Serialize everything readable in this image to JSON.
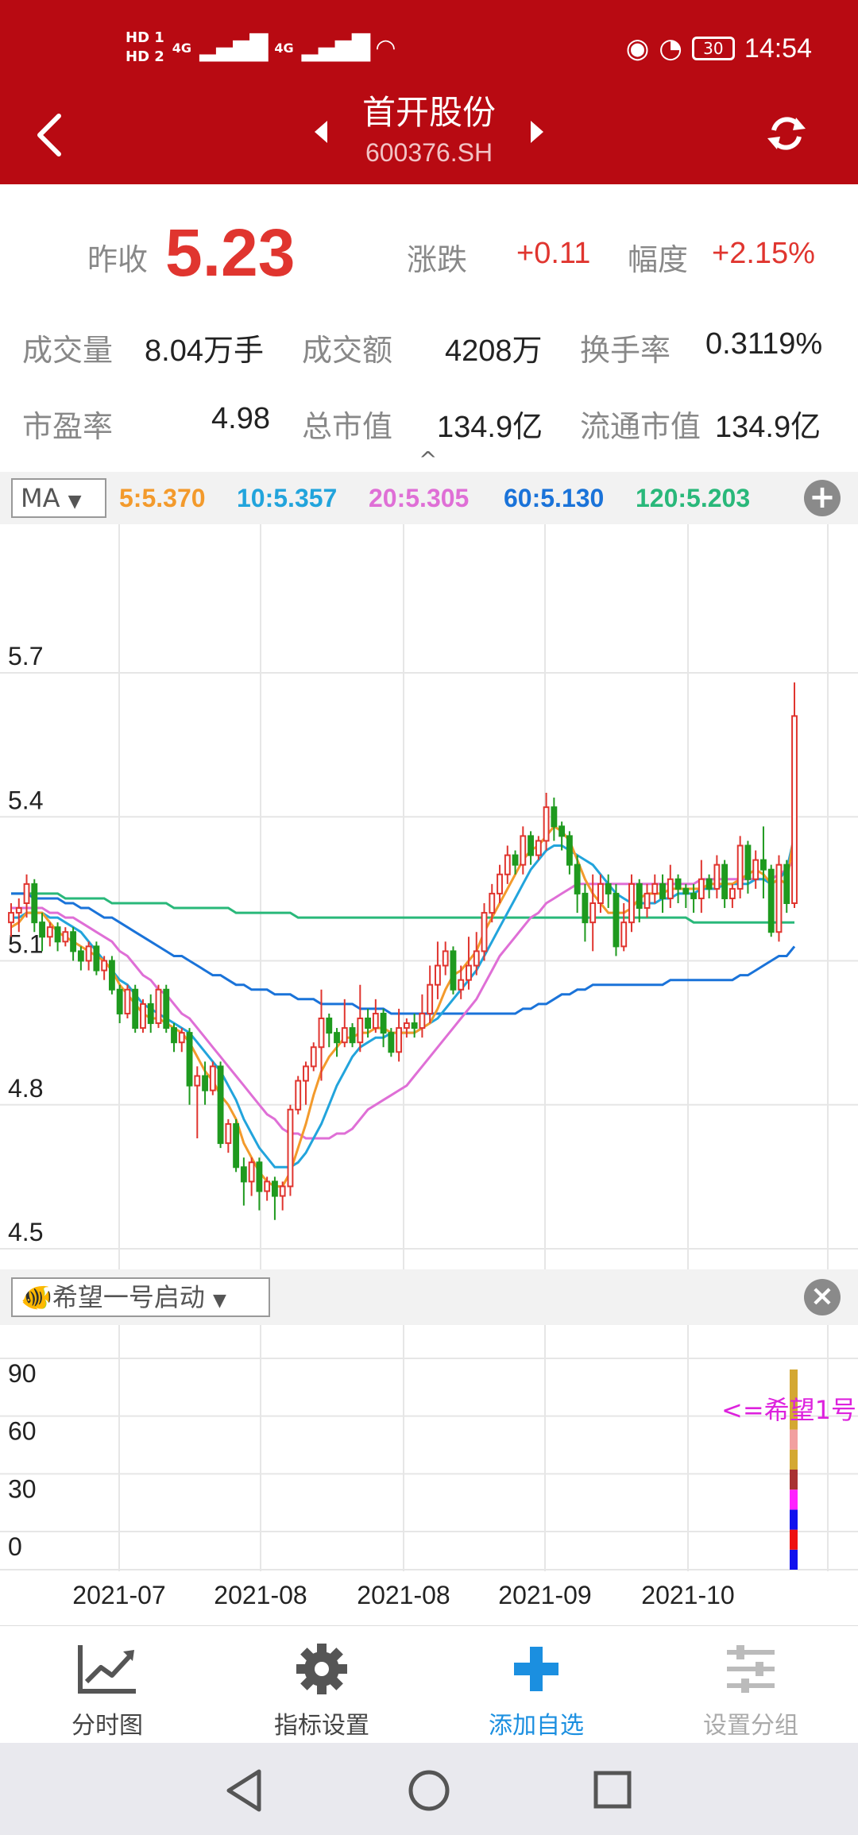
{
  "status_bar": {
    "hd1": "HD 1",
    "hd2": "HD 2",
    "net1": "4G",
    "net2": "4G",
    "battery": "30",
    "time": "14:54"
  },
  "header": {
    "title": "首开股份",
    "code": "600376.SH",
    "back_icon": "back-arrow-icon",
    "refresh_icon": "refresh-icon",
    "background": "#b80a12"
  },
  "quote": {
    "prev_close_label": "昨收",
    "prev_close_value": "5.23",
    "change_label": "涨跌",
    "change_value": "+0.11",
    "pct_label": "幅度",
    "pct_value": "+2.15%",
    "volume_label": "成交量",
    "volume_value": "8.04万手",
    "amount_label": "成交额",
    "amount_value": "4208万",
    "turnover_label": "换手率",
    "turnover_value": "0.3119%",
    "pe_label": "市盈率",
    "pe_value": "4.98",
    "mktcap_label": "总市值",
    "mktcap_value": "134.9亿",
    "float_label": "流通市值",
    "float_value": "134.9亿",
    "collapse_icon": "^"
  },
  "ma_bar": {
    "selector": "MA",
    "ma5": "5:5.370",
    "ma10": "10:5.357",
    "ma20": "20:5.305",
    "ma60": "60:5.130",
    "ma120": "120:5.203",
    "add_icon": "+",
    "colors": {
      "ma5": "#f39a2c",
      "ma10": "#22a4dc",
      "ma20": "#df6fd6",
      "ma60": "#1a73d9",
      "ma120": "#29b87a"
    }
  },
  "indicator_bar": {
    "selector": "🐠希望一号启动",
    "close_icon": "×",
    "label": "<=希望1号"
  },
  "chart_data": [
    {
      "type": "candlestick",
      "ylim": [
        4.5,
        5.7
      ],
      "yticks": [
        "5.7",
        "5.4",
        "5.1",
        "4.8",
        "4.5"
      ],
      "up_color": "#e0352f",
      "down_color": "#1f9a1f",
      "candles": [
        [
          5.18,
          5.2,
          5.15,
          5.22
        ],
        [
          5.2,
          5.21,
          5.16,
          5.23
        ],
        [
          5.22,
          5.26,
          5.19,
          5.28
        ],
        [
          5.26,
          5.18,
          5.16,
          5.27
        ],
        [
          5.18,
          5.15,
          5.12,
          5.2
        ],
        [
          5.15,
          5.17,
          5.13,
          5.18
        ],
        [
          5.17,
          5.14,
          5.12,
          5.18
        ],
        [
          5.14,
          5.16,
          5.13,
          5.17
        ],
        [
          5.16,
          5.12,
          5.1,
          5.17
        ],
        [
          5.12,
          5.1,
          5.08,
          5.13
        ],
        [
          5.1,
          5.13,
          5.08,
          5.14
        ],
        [
          5.13,
          5.08,
          5.07,
          5.14
        ],
        [
          5.08,
          5.1,
          5.06,
          5.11
        ],
        [
          5.1,
          5.04,
          5.03,
          5.11
        ],
        [
          5.04,
          4.99,
          4.97,
          5.05
        ],
        [
          4.99,
          5.04,
          4.98,
          5.05
        ],
        [
          5.04,
          4.96,
          4.95,
          5.05
        ],
        [
          4.96,
          5.01,
          4.95,
          5.02
        ],
        [
          5.01,
          4.97,
          4.95,
          5.03
        ],
        [
          4.97,
          5.04,
          4.96,
          5.05
        ],
        [
          5.04,
          4.96,
          4.95,
          5.05
        ],
        [
          4.96,
          4.93,
          4.91,
          4.97
        ],
        [
          4.93,
          4.95,
          4.91,
          4.96
        ],
        [
          4.95,
          4.84,
          4.8,
          4.96
        ],
        [
          4.84,
          4.86,
          4.73,
          4.88
        ],
        [
          4.86,
          4.83,
          4.8,
          4.89
        ],
        [
          4.83,
          4.88,
          4.82,
          4.89
        ],
        [
          4.88,
          4.72,
          4.71,
          4.89
        ],
        [
          4.72,
          4.76,
          4.7,
          4.77
        ],
        [
          4.76,
          4.67,
          4.66,
          4.77
        ],
        [
          4.67,
          4.64,
          4.59,
          4.69
        ],
        [
          4.64,
          4.68,
          4.61,
          4.69
        ],
        [
          4.68,
          4.62,
          4.58,
          4.69
        ],
        [
          4.62,
          4.64,
          4.6,
          4.65
        ],
        [
          4.64,
          4.61,
          4.56,
          4.65
        ],
        [
          4.61,
          4.63,
          4.58,
          4.64
        ],
        [
          4.63,
          4.79,
          4.61,
          4.8
        ],
        [
          4.79,
          4.85,
          4.78,
          4.86
        ],
        [
          4.85,
          4.88,
          4.8,
          4.89
        ],
        [
          4.88,
          4.92,
          4.87,
          4.93
        ],
        [
          4.92,
          4.98,
          4.85,
          5.04
        ],
        [
          4.98,
          4.95,
          4.92,
          4.99
        ],
        [
          4.95,
          4.93,
          4.9,
          4.96
        ],
        [
          4.93,
          4.96,
          4.92,
          5.02
        ],
        [
          4.96,
          4.93,
          4.92,
          4.97
        ],
        [
          4.93,
          4.98,
          4.91,
          5.05
        ],
        [
          4.98,
          4.96,
          4.94,
          5.0
        ],
        [
          4.96,
          4.99,
          4.95,
          5.02
        ],
        [
          4.99,
          4.95,
          4.92,
          5.0
        ],
        [
          4.95,
          4.91,
          4.9,
          4.96
        ],
        [
          4.91,
          4.96,
          4.89,
          5.0
        ],
        [
          4.96,
          4.97,
          4.94,
          4.98
        ],
        [
          4.97,
          4.96,
          4.94,
          4.99
        ],
        [
          4.96,
          4.99,
          4.94,
          5.03
        ],
        [
          4.99,
          5.05,
          4.97,
          5.09
        ],
        [
          5.05,
          5.09,
          5.02,
          5.14
        ],
        [
          5.09,
          5.12,
          5.07,
          5.14
        ],
        [
          5.12,
          5.04,
          5.03,
          5.13
        ],
        [
          5.04,
          5.06,
          5.02,
          5.09
        ],
        [
          5.06,
          5.09,
          5.04,
          5.15
        ],
        [
          5.09,
          5.12,
          5.07,
          5.16
        ],
        [
          5.12,
          5.2,
          5.1,
          5.22
        ],
        [
          5.2,
          5.24,
          5.18,
          5.26
        ],
        [
          5.24,
          5.28,
          5.22,
          5.3
        ],
        [
          5.28,
          5.32,
          5.26,
          5.34
        ],
        [
          5.32,
          5.3,
          5.28,
          5.33
        ],
        [
          5.3,
          5.36,
          5.28,
          5.38
        ],
        [
          5.36,
          5.32,
          5.3,
          5.37
        ],
        [
          5.32,
          5.35,
          5.31,
          5.36
        ],
        [
          5.35,
          5.42,
          5.33,
          5.45
        ],
        [
          5.42,
          5.38,
          5.35,
          5.44
        ],
        [
          5.38,
          5.36,
          5.33,
          5.39
        ],
        [
          5.36,
          5.3,
          5.28,
          5.37
        ],
        [
          5.3,
          5.24,
          5.2,
          5.32
        ],
        [
          5.24,
          5.18,
          5.14,
          5.26
        ],
        [
          5.18,
          5.22,
          5.12,
          5.28
        ],
        [
          5.22,
          5.26,
          5.2,
          5.28
        ],
        [
          5.26,
          5.24,
          5.21,
          5.28
        ],
        [
          5.24,
          5.13,
          5.11,
          5.26
        ],
        [
          5.13,
          5.18,
          5.12,
          5.22
        ],
        [
          5.18,
          5.26,
          5.16,
          5.28
        ],
        [
          5.26,
          5.21,
          5.18,
          5.27
        ],
        [
          5.21,
          5.24,
          5.19,
          5.26
        ],
        [
          5.24,
          5.26,
          5.22,
          5.28
        ],
        [
          5.26,
          5.23,
          5.2,
          5.28
        ],
        [
          5.23,
          5.27,
          5.21,
          5.3
        ],
        [
          5.27,
          5.25,
          5.22,
          5.28
        ],
        [
          5.25,
          5.24,
          5.21,
          5.26
        ],
        [
          5.24,
          5.23,
          5.2,
          5.26
        ],
        [
          5.23,
          5.27,
          5.2,
          5.31
        ],
        [
          5.27,
          5.25,
          5.23,
          5.28
        ],
        [
          5.25,
          5.3,
          5.23,
          5.32
        ],
        [
          5.3,
          5.23,
          5.21,
          5.31
        ],
        [
          5.23,
          5.25,
          5.21,
          5.26
        ],
        [
          5.25,
          5.34,
          5.23,
          5.36
        ],
        [
          5.34,
          5.27,
          5.24,
          5.35
        ],
        [
          5.27,
          5.31,
          5.25,
          5.33
        ],
        [
          5.31,
          5.29,
          5.23,
          5.38
        ],
        [
          5.29,
          5.16,
          5.15,
          5.3
        ],
        [
          5.16,
          5.3,
          5.14,
          5.32
        ],
        [
          5.3,
          5.22,
          5.2,
          5.31
        ],
        [
          5.22,
          5.61,
          5.21,
          5.68
        ]
      ],
      "ma5": [
        5.17,
        5.18,
        5.2,
        5.2,
        5.2,
        5.18,
        5.16,
        5.15,
        5.14,
        5.13,
        5.12,
        5.11,
        5.1,
        5.08,
        5.05,
        5.03,
        5.01,
        4.99,
        4.98,
        4.98,
        4.97,
        4.96,
        4.95,
        4.93,
        4.9,
        4.87,
        4.85,
        4.82,
        4.8,
        4.77,
        4.72,
        4.69,
        4.66,
        4.64,
        4.63,
        4.63,
        4.66,
        4.71,
        4.76,
        4.82,
        4.87,
        4.9,
        4.92,
        4.94,
        4.94,
        4.95,
        4.95,
        4.96,
        4.96,
        4.95,
        4.95,
        4.95,
        4.95,
        4.96,
        4.97,
        5.0,
        5.04,
        5.07,
        5.08,
        5.1,
        5.12,
        5.16,
        5.19,
        5.22,
        5.25,
        5.28,
        5.31,
        5.33,
        5.34,
        5.36,
        5.38,
        5.37,
        5.35,
        5.31,
        5.27,
        5.24,
        5.22,
        5.2,
        5.2,
        5.2,
        5.21,
        5.23,
        5.24,
        5.24,
        5.24,
        5.25,
        5.25,
        5.25,
        5.25,
        5.25,
        5.26,
        5.26,
        5.26,
        5.26,
        5.27,
        5.28,
        5.29,
        5.28,
        5.26,
        5.27,
        5.26,
        5.37
      ],
      "ma10": [
        5.19,
        5.19,
        5.2,
        5.2,
        5.2,
        5.19,
        5.19,
        5.18,
        5.17,
        5.16,
        5.14,
        5.12,
        5.1,
        5.08,
        5.06,
        5.05,
        5.03,
        5.01,
        5.0,
        4.99,
        4.98,
        4.97,
        4.96,
        4.95,
        4.93,
        4.91,
        4.89,
        4.87,
        4.84,
        4.81,
        4.77,
        4.74,
        4.71,
        4.69,
        4.67,
        4.67,
        4.67,
        4.68,
        4.7,
        4.73,
        4.76,
        4.8,
        4.84,
        4.87,
        4.9,
        4.92,
        4.93,
        4.94,
        4.94,
        4.95,
        4.95,
        4.95,
        4.95,
        4.96,
        4.97,
        4.98,
        5.0,
        5.02,
        5.04,
        5.06,
        5.08,
        5.11,
        5.14,
        5.17,
        5.2,
        5.23,
        5.26,
        5.29,
        5.31,
        5.33,
        5.34,
        5.34,
        5.33,
        5.32,
        5.31,
        5.3,
        5.28,
        5.26,
        5.24,
        5.23,
        5.22,
        5.22,
        5.22,
        5.22,
        5.23,
        5.23,
        5.24,
        5.24,
        5.24,
        5.25,
        5.25,
        5.25,
        5.26,
        5.26,
        5.26,
        5.26,
        5.27,
        5.27,
        5.26,
        5.27,
        5.29,
        5.36
      ],
      "ma20": [
        5.21,
        5.21,
        5.21,
        5.21,
        5.21,
        5.2,
        5.2,
        5.19,
        5.19,
        5.18,
        5.17,
        5.16,
        5.15,
        5.14,
        5.12,
        5.11,
        5.09,
        5.07,
        5.06,
        5.04,
        5.03,
        5.01,
        4.99,
        4.98,
        4.96,
        4.94,
        4.92,
        4.9,
        4.88,
        4.86,
        4.84,
        4.82,
        4.8,
        4.78,
        4.77,
        4.75,
        4.74,
        4.74,
        4.73,
        4.73,
        4.73,
        4.73,
        4.74,
        4.74,
        4.75,
        4.77,
        4.79,
        4.8,
        4.81,
        4.82,
        4.83,
        4.84,
        4.86,
        4.88,
        4.9,
        4.92,
        4.94,
        4.96,
        4.98,
        5.0,
        5.02,
        5.05,
        5.08,
        5.11,
        5.13,
        5.15,
        5.17,
        5.19,
        5.2,
        5.22,
        5.23,
        5.24,
        5.25,
        5.26,
        5.26,
        5.26,
        5.26,
        5.26,
        5.26,
        5.26,
        5.26,
        5.26,
        5.26,
        5.26,
        5.26,
        5.26,
        5.26,
        5.26,
        5.26,
        5.27,
        5.27,
        5.27,
        5.27,
        5.27,
        5.27,
        5.27,
        5.27,
        5.27,
        5.27,
        5.28,
        5.29,
        5.31
      ],
      "ma60": [
        5.24,
        5.24,
        5.24,
        5.23,
        5.23,
        5.23,
        5.23,
        5.22,
        5.22,
        5.21,
        5.21,
        5.2,
        5.19,
        5.19,
        5.18,
        5.17,
        5.16,
        5.15,
        5.14,
        5.13,
        5.12,
        5.11,
        5.11,
        5.1,
        5.09,
        5.08,
        5.07,
        5.07,
        5.06,
        5.05,
        5.05,
        5.04,
        5.04,
        5.04,
        5.03,
        5.03,
        5.03,
        5.02,
        5.02,
        5.02,
        5.01,
        5.01,
        5.01,
        5.01,
        5.01,
        5.0,
        5.0,
        5.0,
        5.0,
        4.99,
        4.99,
        4.99,
        4.99,
        4.99,
        4.99,
        4.99,
        4.99,
        4.99,
        4.99,
        4.99,
        4.99,
        4.99,
        4.99,
        4.99,
        4.99,
        4.99,
        5.0,
        5.0,
        5.01,
        5.01,
        5.02,
        5.03,
        5.03,
        5.04,
        5.04,
        5.05,
        5.05,
        5.05,
        5.05,
        5.05,
        5.05,
        5.05,
        5.05,
        5.05,
        5.05,
        5.06,
        5.06,
        5.06,
        5.06,
        5.06,
        5.06,
        5.06,
        5.06,
        5.06,
        5.07,
        5.07,
        5.08,
        5.09,
        5.1,
        5.11,
        5.11,
        5.13
      ],
      "ma120": [
        5.24,
        5.24,
        5.24,
        5.24,
        5.24,
        5.24,
        5.24,
        5.23,
        5.23,
        5.23,
        5.23,
        5.23,
        5.23,
        5.22,
        5.22,
        5.22,
        5.22,
        5.22,
        5.22,
        5.22,
        5.22,
        5.21,
        5.21,
        5.21,
        5.21,
        5.21,
        5.21,
        5.21,
        5.21,
        5.2,
        5.2,
        5.2,
        5.2,
        5.2,
        5.2,
        5.2,
        5.2,
        5.19,
        5.19,
        5.19,
        5.19,
        5.19,
        5.19,
        5.19,
        5.19,
        5.19,
        5.19,
        5.19,
        5.19,
        5.19,
        5.19,
        5.19,
        5.19,
        5.19,
        5.19,
        5.19,
        5.19,
        5.19,
        5.19,
        5.19,
        5.19,
        5.19,
        5.19,
        5.19,
        5.19,
        5.19,
        5.19,
        5.19,
        5.19,
        5.19,
        5.19,
        5.19,
        5.19,
        5.19,
        5.19,
        5.19,
        5.19,
        5.19,
        5.19,
        5.19,
        5.19,
        5.19,
        5.19,
        5.19,
        5.19,
        5.19,
        5.19,
        5.19,
        5.18,
        5.18,
        5.18,
        5.18,
        5.18,
        5.18,
        5.18,
        5.18,
        5.18,
        5.18,
        5.18,
        5.18,
        5.18,
        5.18
      ]
    },
    {
      "type": "bar",
      "name": "希望一号",
      "ylim": [
        0,
        100
      ],
      "yticks": [
        "90",
        "60",
        "30",
        "0"
      ],
      "annotation": "<=希望1号",
      "segments": [
        {
          "from": 0,
          "to": 10,
          "color": "#1111ee"
        },
        {
          "from": 10,
          "to": 20,
          "color": "#ee1111"
        },
        {
          "from": 20,
          "to": 30,
          "color": "#1111ee"
        },
        {
          "from": 30,
          "to": 40,
          "color": "#ff22ff"
        },
        {
          "from": 40,
          "to": 50,
          "color": "#a83232"
        },
        {
          "from": 50,
          "to": 60,
          "color": "#d4a832"
        },
        {
          "from": 60,
          "to": 70,
          "color": "#f2a0a0"
        },
        {
          "from": 70,
          "to": 100,
          "color": "#d4a832"
        }
      ]
    }
  ],
  "date_axis": [
    "2021-07",
    "2021-08",
    "2021-08",
    "2021-09",
    "2021-10"
  ],
  "toolbar": [
    {
      "label": "分时图",
      "icon": "timeshare-chart-icon",
      "active": false
    },
    {
      "label": "指标设置",
      "icon": "gear-icon",
      "active": false
    },
    {
      "label": "添加自选",
      "icon": "plus-icon",
      "active": true
    },
    {
      "label": "设置分组",
      "icon": "sliders-icon",
      "active": false
    }
  ],
  "navbar": [
    "back-triangle-icon",
    "home-circle-icon",
    "recents-square-icon"
  ]
}
